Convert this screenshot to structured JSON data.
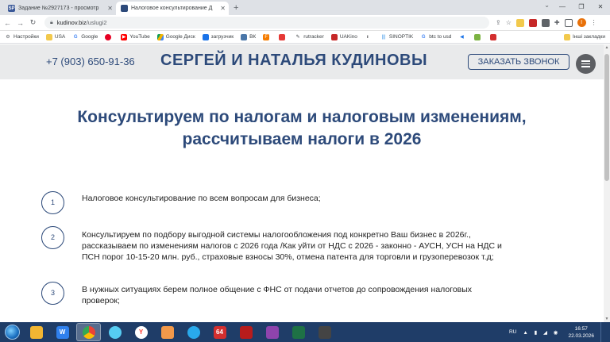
{
  "browser": {
    "tabs": [
      {
        "title": "Задание №2927173 - просмотр",
        "favicon": "SP",
        "color": "#3b5998",
        "active": false
      },
      {
        "title": "Налоговое консультирование Д",
        "favicon": "",
        "color": "#2d4a7a",
        "active": true
      }
    ],
    "new_tab": "+",
    "url_domain": "kudinov.biz",
    "url_path": "/uslugi2",
    "bookmarks": [
      {
        "label": "Настройки",
        "icon": "gear-icon",
        "color": "#5f6368"
      },
      {
        "label": "USA",
        "icon": "folder-icon",
        "color": "#f2c94c"
      },
      {
        "label": "Google",
        "icon": "google-icon",
        "color": "#4285f4"
      },
      {
        "label": "",
        "icon": "pinterest-icon",
        "color": "#e60023"
      },
      {
        "label": "YouTube",
        "icon": "youtube-icon",
        "color": "#ff0000"
      },
      {
        "label": "Google Диск",
        "icon": "drive-icon",
        "color": "#0f9d58"
      },
      {
        "label": "загрузчик",
        "icon": "download-icon",
        "color": "#1a73e8"
      },
      {
        "label": "ВК",
        "icon": "vk-icon",
        "color": "#4a76a8"
      },
      {
        "label": "",
        "icon": "f-icon",
        "color": "#f57c00"
      },
      {
        "label": "",
        "icon": "grid-icon",
        "color": "#e53935"
      },
      {
        "label": "rutracker",
        "icon": "rutracker-icon",
        "color": "#3c4043"
      },
      {
        "label": "UAKino",
        "icon": "uakino-icon",
        "color": "#c62828"
      },
      {
        "label": "",
        "icon": "mark-icon",
        "color": "#202124"
      },
      {
        "label": "SINOPTIK",
        "icon": "sinoptik-icon",
        "color": "#1e88e5"
      },
      {
        "label": "btc to usd",
        "icon": "google-icon",
        "color": "#4285f4"
      },
      {
        "label": "",
        "icon": "arrow-icon",
        "color": "#1a73e8"
      },
      {
        "label": "",
        "icon": "d-icon",
        "color": "#7cb342"
      },
      {
        "label": "",
        "icon": "red-icon",
        "color": "#d32f2f"
      }
    ],
    "other_bookmarks": "Інші закладки",
    "profile_initial": "I"
  },
  "site": {
    "phone": "+7 (903) 650-91-36",
    "brand": "СЕРГЕЙ И НАТАЛЬЯ КУДИНОВЫ",
    "call_button": "ЗАКАЗАТЬ ЗВОНОК",
    "accent_color": "#2d4a7a"
  },
  "main": {
    "heading_line1": "Консультируем по налогам и налоговым изменениям,",
    "heading_line2": "рассчитываем налоги в 2026",
    "items": [
      {
        "num": "1",
        "lines": [
          "Налоговое консультирование по всем вопросам для бизнеса;"
        ]
      },
      {
        "num": "2",
        "lines": [
          "Консультируем по подбору выгодной системы налогообложения под конкретно Ваш бизнес в 2026г.,",
          "рассказываем по изменениям налогов с 2026 года /Как уйти от НДС с 2026 - законно - АУСН, УСН на НДС и",
          "ПСН порог 10-15-20 млн. руб., страховые взносы 30%, отмена патента для торговли и грузоперевозок т.д;"
        ]
      },
      {
        "num": "3",
        "lines": [
          "В нужных ситуациях берем полное общение с ФНС от подачи отчетов до сопровождения налоговых",
          "проверок;"
        ]
      }
    ]
  },
  "taskbar": {
    "apps": [
      {
        "name": "explorer-icon",
        "color": "#f2b632",
        "label": ""
      },
      {
        "name": "wise-icon",
        "color": "#2f80ed",
        "label": "W"
      },
      {
        "name": "chrome-icon",
        "color": "#34a853",
        "label": ""
      },
      {
        "name": "network-icon",
        "color": "#56ccf2",
        "label": ""
      },
      {
        "name": "yandex-icon",
        "color": "#ff3b30",
        "label": "Y"
      },
      {
        "name": "media-icon",
        "color": "#f2994a",
        "label": ""
      },
      {
        "name": "telegram-icon",
        "color": "#29a9eb",
        "label": ""
      },
      {
        "name": "aida-icon",
        "color": "#d32f2f",
        "label": "64"
      },
      {
        "name": "filezilla-icon",
        "color": "#b71c1c",
        "label": ""
      },
      {
        "name": "winrar-icon",
        "color": "#8e44ad",
        "label": ""
      },
      {
        "name": "excel-icon",
        "color": "#1e7145",
        "label": ""
      },
      {
        "name": "app-icon",
        "color": "#444",
        "label": ""
      }
    ],
    "lang": "RU",
    "time": "16:57",
    "date": "22.03.2026"
  }
}
